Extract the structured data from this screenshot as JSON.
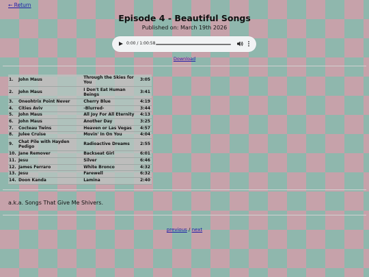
{
  "nav": {
    "back_label": "← Return"
  },
  "episode": {
    "title": "Episode 4 - Beautiful Songs",
    "published": "Published on: March 19th 2026"
  },
  "player": {
    "time_display": "0:00 / 1:00:58",
    "progress": 0,
    "play_icon": "play-icon",
    "volume_icon": "volume-icon",
    "more_icon": "more-options-icon"
  },
  "download_label": "Download",
  "tracks": [
    {
      "num": "1.",
      "artist": "John Maus",
      "song": "Through the Skies for You",
      "duration": "3:05"
    },
    {
      "num": "2.",
      "artist": "John Maus",
      "song": "I Don't Eat Human Beings",
      "duration": "3:41"
    },
    {
      "num": "3.",
      "artist": "Oneohtrix Point Never",
      "song": "Cherry Blue",
      "duration": "4:19"
    },
    {
      "num": "4.",
      "artist": "Cities Aviv",
      "song": "-Blurred-",
      "duration": "3:44"
    },
    {
      "num": "5.",
      "artist": "John Maus",
      "song": "All Joy For All Eternity",
      "duration": "4:13"
    },
    {
      "num": "6.",
      "artist": "John Maus",
      "song": "Another Day",
      "duration": "3:25"
    },
    {
      "num": "7.",
      "artist": "Cocteau Twins",
      "song": "Heaven or Las Vegas",
      "duration": "4:57"
    },
    {
      "num": "8.",
      "artist": "Julee Cruise",
      "song": "Movin' In On You",
      "duration": "4:04"
    },
    {
      "num": "9.",
      "artist": "Chat Pile with Hayden Pedigo",
      "song": "Radioactive Dreams",
      "duration": "2:55"
    },
    {
      "num": "10.",
      "artist": "Jane Remover",
      "song": "Backseat Girl",
      "duration": "6:01"
    },
    {
      "num": "11.",
      "artist": "Jesu",
      "song": "Silver",
      "duration": "6:46"
    },
    {
      "num": "12.",
      "artist": "James Ferraro",
      "song": "White Bronco",
      "duration": "4:32"
    },
    {
      "num": "13.",
      "artist": "Jesu",
      "song": "Farewell",
      "duration": "6:32"
    },
    {
      "num": "14.",
      "artist": "Doon Kanda",
      "song": "Lamina",
      "duration": "2:40"
    }
  ],
  "description": "a.k.a. Songs That Give Me Shivers.",
  "pager": {
    "previous_label": "previous",
    "separator": "/",
    "next_label": "next"
  }
}
